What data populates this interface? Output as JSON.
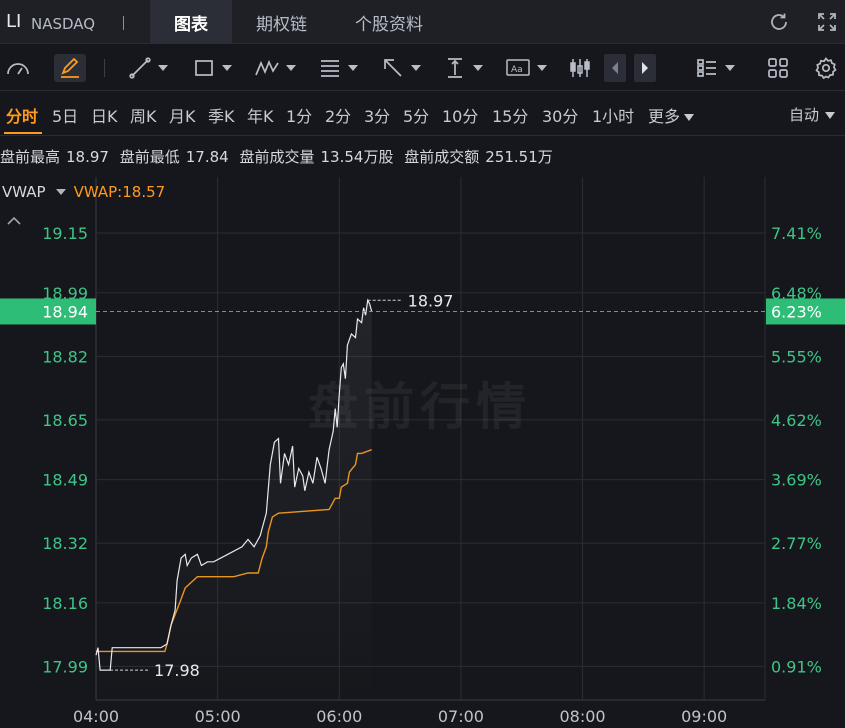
{
  "header": {
    "ticker": "LI",
    "exchange": "NASDAQ",
    "tabs": [
      {
        "label": "图表",
        "active": true
      },
      {
        "label": "期权链",
        "active": false
      },
      {
        "label": "个股资料",
        "active": false
      }
    ],
    "icons": [
      "refresh-icon",
      "fullscreen-icon"
    ]
  },
  "toolbar": {
    "icons": [
      "indicator-gauge-icon",
      "draw-pencil-icon",
      "trend-line-icon",
      "rectangle-icon",
      "wave-pattern-icon",
      "fibonacci-icon",
      "arrow-icon",
      "price-range-icon",
      "text-annotation-icon",
      "candlestick-type-icon",
      "prev-arrow-icon",
      "next-arrow-icon",
      "layout-list-icon",
      "grid-layout-icon",
      "settings-icon"
    ]
  },
  "periods": {
    "items": [
      "分时",
      "5日",
      "日K",
      "周K",
      "月K",
      "季K",
      "年K",
      "1分",
      "2分",
      "3分",
      "5分",
      "10分",
      "15分",
      "30分",
      "1小时"
    ],
    "active": "分时",
    "more_label": "更多",
    "auto_label": "自动"
  },
  "stats": {
    "high_label": "盘前最高",
    "high_value": "18.97",
    "low_label": "盘前最低",
    "low_value": "17.84",
    "volume_label": "盘前成交量",
    "volume_value": "13.54万股",
    "turnover_label": "盘前成交额",
    "turnover_value": "251.51万"
  },
  "indicator": {
    "name": "VWAP",
    "value_text": "VWAP:18.57"
  },
  "colors": {
    "price_line": "#e8e8ec",
    "vwap_line": "#e8961e",
    "axis_green": "#3ec486",
    "current_tag": "#2ebd77",
    "grid": "#2b2d34"
  },
  "chart_data": {
    "type": "line",
    "watermark": "盘前行情",
    "x_ticks": [
      "04:00",
      "05:00",
      "06:00",
      "07:00",
      "08:00",
      "09:00"
    ],
    "xlim": [
      "04:00",
      "09:30"
    ],
    "y_left_ticks": [
      "19.15",
      "18.99",
      "18.82",
      "18.65",
      "18.49",
      "18.32",
      "18.16",
      "17.99"
    ],
    "y_right_ticks": [
      "7.41%",
      "6.48%",
      "5.55%",
      "4.62%",
      "3.69%",
      "2.77%",
      "1.84%",
      "0.91%"
    ],
    "ylim": [
      17.9,
      19.3
    ],
    "current_price": "18.94",
    "current_pct": "6.23%",
    "high_marker": {
      "time": "06:14",
      "value": 18.97,
      "label": "18.97"
    },
    "low_marker": {
      "time": "04:02",
      "value": 17.98,
      "label": "17.98"
    },
    "series": [
      {
        "name": "Price",
        "points": [
          [
            "04:00",
            18.02
          ],
          [
            "04:01",
            18.04
          ],
          [
            "04:02",
            17.98
          ],
          [
            "04:05",
            17.98
          ],
          [
            "04:07",
            17.98
          ],
          [
            "04:08",
            18.04
          ],
          [
            "04:20",
            18.04
          ],
          [
            "04:32",
            18.04
          ],
          [
            "04:35",
            18.05
          ],
          [
            "04:37",
            18.1
          ],
          [
            "04:39",
            18.14
          ],
          [
            "04:40",
            18.22
          ],
          [
            "04:42",
            18.28
          ],
          [
            "04:44",
            18.29
          ],
          [
            "04:45",
            18.26
          ],
          [
            "04:47",
            18.28
          ],
          [
            "04:50",
            18.29
          ],
          [
            "04:52",
            18.26
          ],
          [
            "04:55",
            18.27
          ],
          [
            "04:58",
            18.27
          ],
          [
            "05:05",
            18.29
          ],
          [
            "05:12",
            18.31
          ],
          [
            "05:15",
            18.33
          ],
          [
            "05:18",
            18.31
          ],
          [
            "05:21",
            18.34
          ],
          [
            "05:24",
            18.4
          ],
          [
            "05:26",
            18.53
          ],
          [
            "05:28",
            18.59
          ],
          [
            "05:30",
            18.6
          ],
          [
            "05:31",
            18.48
          ],
          [
            "05:33",
            18.56
          ],
          [
            "05:35",
            18.53
          ],
          [
            "05:37",
            18.58
          ],
          [
            "05:38",
            18.47
          ],
          [
            "05:40",
            18.52
          ],
          [
            "05:42",
            18.5
          ],
          [
            "05:43",
            18.46
          ],
          [
            "05:45",
            18.51
          ],
          [
            "05:47",
            18.48
          ],
          [
            "05:49",
            18.55
          ],
          [
            "05:51",
            18.52
          ],
          [
            "05:53",
            18.48
          ],
          [
            "05:55",
            18.57
          ],
          [
            "05:57",
            18.62
          ],
          [
            "05:58",
            18.68
          ],
          [
            "05:59",
            18.63
          ],
          [
            "06:00",
            18.72
          ],
          [
            "06:01",
            18.79
          ],
          [
            "06:02",
            18.8
          ],
          [
            "06:03",
            18.76
          ],
          [
            "06:04",
            18.85
          ],
          [
            "06:06",
            18.88
          ],
          [
            "06:08",
            18.87
          ],
          [
            "06:09",
            18.92
          ],
          [
            "06:11",
            18.91
          ],
          [
            "06:12",
            18.95
          ],
          [
            "06:13",
            18.93
          ],
          [
            "06:14",
            18.97
          ],
          [
            "06:15",
            18.96
          ],
          [
            "06:16",
            18.94
          ]
        ]
      },
      {
        "name": "VWAP",
        "points": [
          [
            "04:00",
            18.03
          ],
          [
            "04:34",
            18.03
          ],
          [
            "04:35",
            18.05
          ],
          [
            "04:37",
            18.1
          ],
          [
            "04:42",
            18.17
          ],
          [
            "04:44",
            18.2
          ],
          [
            "04:50",
            18.23
          ],
          [
            "05:08",
            18.23
          ],
          [
            "05:15",
            18.24
          ],
          [
            "05:20",
            18.24
          ],
          [
            "05:22",
            18.28
          ],
          [
            "05:24",
            18.31
          ],
          [
            "05:25",
            18.35
          ],
          [
            "05:27",
            18.39
          ],
          [
            "05:30",
            18.4
          ],
          [
            "05:55",
            18.41
          ],
          [
            "05:58",
            18.44
          ],
          [
            "06:00",
            18.44
          ],
          [
            "06:01",
            18.47
          ],
          [
            "06:04",
            18.48
          ],
          [
            "06:05",
            18.51
          ],
          [
            "06:08",
            18.53
          ],
          [
            "06:09",
            18.56
          ],
          [
            "06:11",
            18.56
          ],
          [
            "06:16",
            18.57
          ]
        ]
      }
    ]
  }
}
